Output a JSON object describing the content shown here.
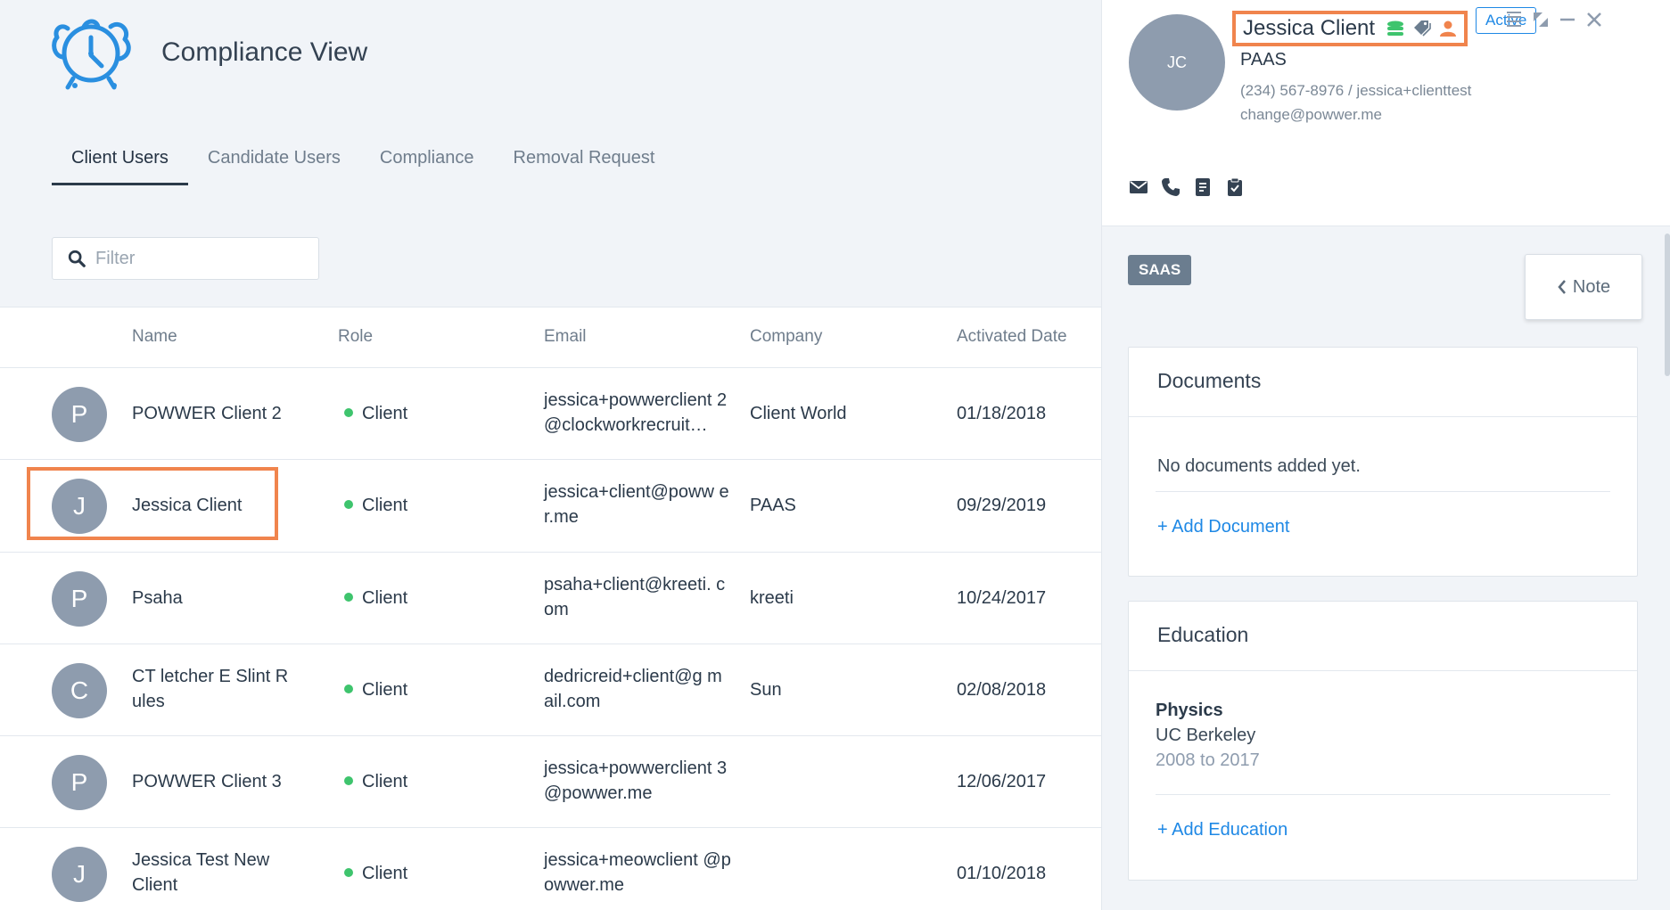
{
  "app": {
    "title": "Compliance View",
    "logo_icon": "alarm-clock-logo-icon"
  },
  "tabs": [
    {
      "label": "Client Users",
      "active": true
    },
    {
      "label": "Candidate Users",
      "active": false
    },
    {
      "label": "Compliance",
      "active": false
    },
    {
      "label": "Removal Request",
      "active": false
    }
  ],
  "filter": {
    "placeholder": "Filter",
    "value": ""
  },
  "table": {
    "columns": [
      "Name",
      "Role",
      "Email",
      "Company",
      "Activated Date"
    ],
    "rows": [
      {
        "initial": "P",
        "name": "POWWER Client 2",
        "role": "Client",
        "email": "jessica+powwerclient 2@clockworkrecruit…",
        "company": "Client World",
        "date": "01/18/2018"
      },
      {
        "initial": "J",
        "name": "Jessica Client",
        "role": "Client",
        "email": "jessica+client@poww er.me",
        "company": "PAAS",
        "date": "09/29/2019",
        "selected": true
      },
      {
        "initial": "P",
        "name": "Psaha",
        "role": "Client",
        "email": "psaha+client@kreeti. com",
        "company": "kreeti",
        "date": "10/24/2017"
      },
      {
        "initial": "C",
        "name": "CT letcher E Slint R ules",
        "role": "Client",
        "email": "dedricreid+client@g mail.com",
        "company": "Sun",
        "date": "02/08/2018"
      },
      {
        "initial": "P",
        "name": "POWWER Client 3",
        "role": "Client",
        "email": "jessica+powwerclient 3@powwer.me",
        "company": "",
        "date": "12/06/2017"
      },
      {
        "initial": "J",
        "name": "Jessica Test New Client",
        "role": "Client",
        "email": "jessica+meowclient @powwer.me",
        "company": "",
        "date": "01/10/2018"
      }
    ]
  },
  "profile": {
    "initials": "JC",
    "name": "Jessica Client",
    "status": "Active",
    "company": "PAAS",
    "contact": "(234) 567-8976 / jessica+clienttestchange@powwer.me",
    "tag": "SAAS",
    "note_label": "Note",
    "name_icons": [
      "stack-icon",
      "tags-icon",
      "person-icon"
    ],
    "action_icons": [
      "email-icon",
      "phone-icon",
      "document-icon",
      "clipboard-check-icon"
    ]
  },
  "documents": {
    "title": "Documents",
    "empty_text": "No documents added yet.",
    "add_label": "+ Add Document"
  },
  "education": {
    "title": "Education",
    "entries": [
      {
        "field": "Physics",
        "school": "UC Berkeley",
        "years": "2008 to 2017"
      }
    ],
    "add_label": "+ Add Education"
  },
  "colors": {
    "accent_blue": "#1e88e5",
    "highlight_orange": "#f0844d",
    "active_dot_green": "#3ec46d",
    "avatar_gray": "#8e9cae",
    "tag_gray": "#6b7d8f"
  }
}
